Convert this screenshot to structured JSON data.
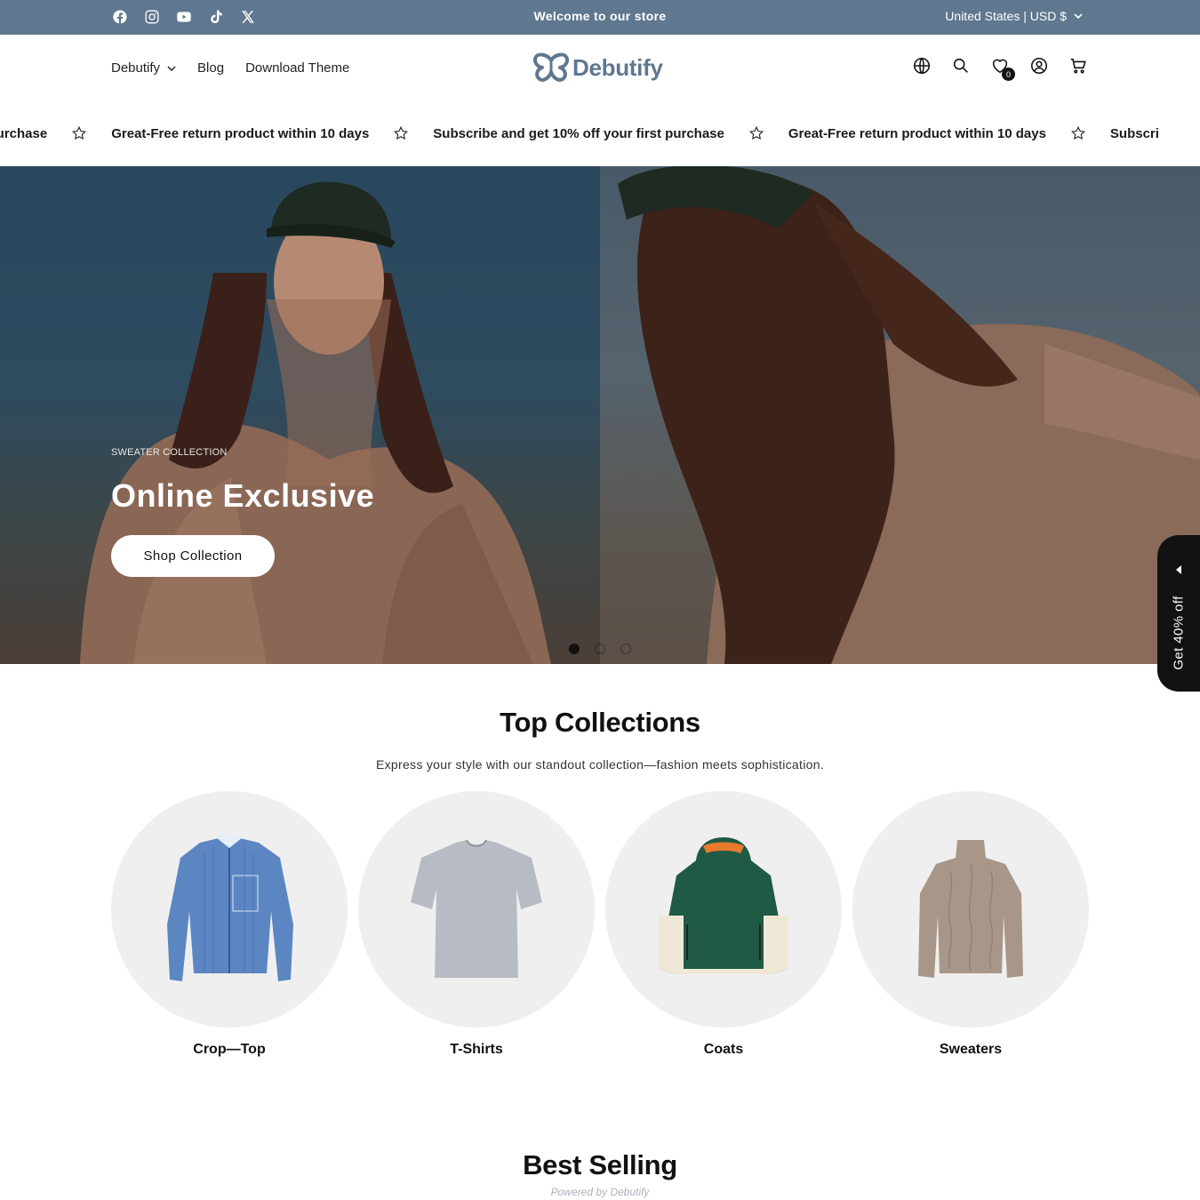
{
  "announcement": {
    "welcome": "Welcome to our store",
    "locale": "United States | USD $",
    "socials": [
      "facebook-icon",
      "instagram-icon",
      "youtube-icon",
      "tiktok-icon",
      "x-icon"
    ]
  },
  "header": {
    "nav": [
      {
        "label": "Debutify",
        "has_dropdown": true
      },
      {
        "label": "Blog",
        "has_dropdown": false
      },
      {
        "label": "Download Theme",
        "has_dropdown": false
      }
    ],
    "logo_text": "Debutify",
    "wishlist_count": "0",
    "icons": [
      "globe-icon",
      "search-icon",
      "wishlist-icon",
      "account-icon",
      "cart-icon"
    ]
  },
  "marquee": {
    "items": [
      "r first purchase",
      "Great-Free return product within 10 days",
      "Subscribe and get 10% off your first purchase",
      "Great-Free return product within 10 days",
      "Subscri"
    ]
  },
  "hero": {
    "eyebrow": "SWEATER COLLECTION",
    "title": "Online Exclusive",
    "button": "Shop Collection",
    "slides": 3,
    "active_slide": 1
  },
  "side_tab": {
    "label": "Get 40% off"
  },
  "top_collections": {
    "title": "Top Collections",
    "subtitle": "Express your style with our standout collection—fashion meets sophistication.",
    "items": [
      {
        "label": "Crop—Top"
      },
      {
        "label": "T-Shirts"
      },
      {
        "label": "Coats"
      },
      {
        "label": "Sweaters"
      }
    ]
  },
  "best_selling": {
    "title": "Best Selling"
  },
  "colors": {
    "topbar": "#5f778f",
    "logo": "#5f778f",
    "text": "#111111"
  },
  "footer_watermark": "Powered by Debutify"
}
